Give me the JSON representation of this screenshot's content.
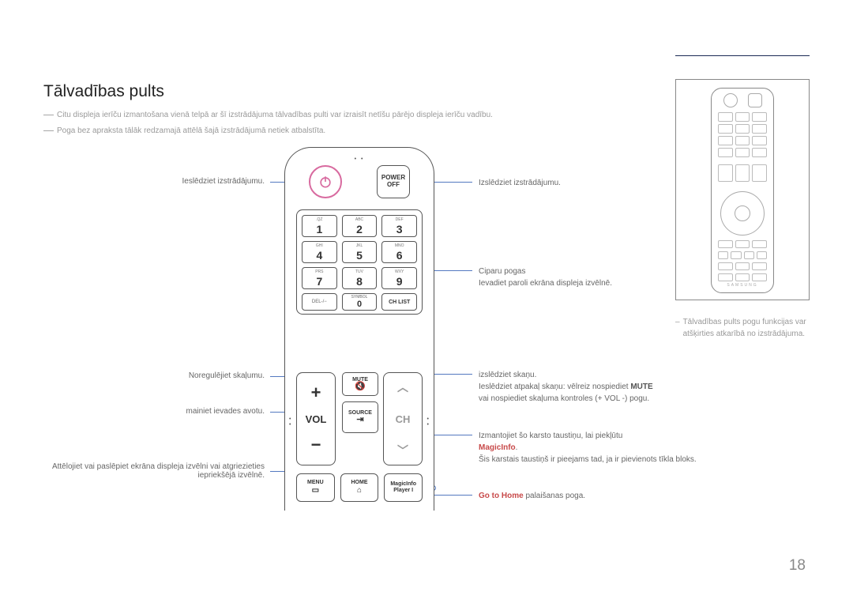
{
  "title": "Tālvadības pults",
  "notes": {
    "n1": "Citu displeja ierīču izmantošana vienā telpā ar šī izstrādājuma tālvadības pulti var izraisīt netīšu pārējo displeja ierīču vadību.",
    "n2": "Poga bez apraksta tālāk redzamajā attēlā šajā izstrādājumā netiek atbalstīta."
  },
  "left": {
    "power_on": "Ieslēdziet izstrādājumu.",
    "volume": "Noregulējiet skaļumu.",
    "source": "mainiet ievades avotu.",
    "menu": "Attēlojiet vai paslēpiet ekrāna displeja izvēlni vai atgriezieties iepriekšējā izvēlnē."
  },
  "right": {
    "power_off": "Izslēdziet izstrādājumu.",
    "digits_a": "Ciparu pogas",
    "digits_b": "Ievadiet paroli ekrāna displeja izvēlnē.",
    "mute_a": "izslēdziet skaņu.",
    "mute_b_pre": "Ieslēdziet atpakaļ skaņu: vēlreiz nospiediet ",
    "mute_b_bold": "MUTE",
    "mute_c": "vai nospiediet skaļuma kontroles (+ VOL -) pogu.",
    "magic_a": "Izmantojiet šo karsto taustiņu, lai piekļūtu",
    "magic_link": "MagicInfo",
    "magic_dot": ".",
    "magic_b": "Šis karstais taustiņš ir pieejams tad, ja ir pievienots tīkla bloks.",
    "home_pre": "Go to Home",
    "home_post": " palaišanas poga."
  },
  "remote": {
    "power_off_a": "POWER",
    "power_off_b": "OFF",
    "keys": {
      "k1l": ".QZ",
      "k2l": "ABC",
      "k3l": "DEF",
      "k4l": "GHI",
      "k5l": "JKL",
      "k6l": "MNO",
      "k7l": "PRS",
      "k8l": "TUV",
      "k9l": "WXY",
      "del": "DEL-/−",
      "sym": "SYMBOL",
      "chlist": "CH LIST",
      "d1": "1",
      "d2": "2",
      "d3": "3",
      "d4": "4",
      "d5": "5",
      "d6": "6",
      "d7": "7",
      "d8": "8",
      "d9": "9",
      "d0": "0"
    },
    "vol": "VOL",
    "ch": "CH",
    "mute": "MUTE",
    "source": "SOURCE",
    "menu": "MENU",
    "home": "HOME",
    "magic_a": "MagicInfo",
    "magic_b": "Player I"
  },
  "side_note": "Tālvadības pults pogu funkcijas var atšķirties atkarībā no izstrādājuma.",
  "mini_brand": "SAMSUNG",
  "page": "18"
}
